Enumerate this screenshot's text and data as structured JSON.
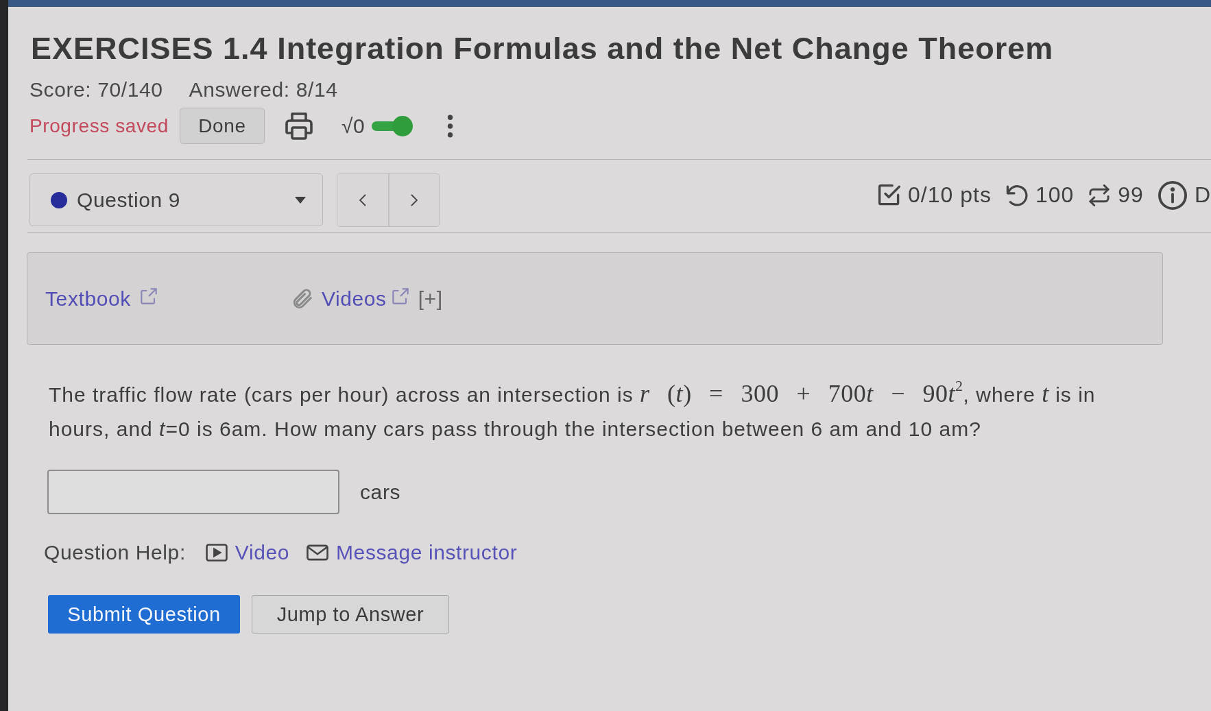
{
  "title": "EXERCISES 1.4 Integration Formulas and the Net Change Theorem",
  "score": "Score: 70/140",
  "answered": "Answered: 8/14",
  "toolbar": {
    "status": "Progress saved",
    "done_button": "Done",
    "math_toggle": {
      "label": "√0",
      "on": true
    }
  },
  "question_nav": {
    "question": "Question 9"
  },
  "stats": [
    {
      "kind": "points",
      "text": "0/10 pts"
    },
    {
      "kind": "retries",
      "text": "100"
    },
    {
      "kind": "attempts",
      "text": "99"
    },
    {
      "kind": "details",
      "text": "D"
    }
  ],
  "resources": [
    {
      "kind": "textbook",
      "label": "Textbook"
    },
    {
      "kind": "videos",
      "label": "Videos",
      "expand": "[+]"
    }
  ],
  "question": {
    "parts": [
      {
        "kind": "text",
        "text": "The traffic flow rate (cars per hour) across an intersection is "
      },
      {
        "kind": "var",
        "text": "r"
      },
      {
        "kind": "math",
        "text": " ("
      },
      {
        "kind": "var",
        "text": "t"
      },
      {
        "kind": "math",
        "text": ") = 300 + 700"
      },
      {
        "kind": "var",
        "text": "t"
      },
      {
        "kind": "math",
        "text": " − 90"
      },
      {
        "kind": "var",
        "text": "t"
      },
      {
        "kind": "sup",
        "text": "2"
      },
      {
        "kind": "text",
        "text": ", where "
      },
      {
        "kind": "var",
        "text": "t"
      },
      {
        "kind": "text",
        "text": " is in hours, and *t*=0 is 6am. How many cars pass through the intersection between 6 am and 10 am?"
      }
    ],
    "answer": {
      "unit": "cars"
    }
  },
  "help": {
    "label": "Question Help:",
    "links": [
      {
        "kind": "video",
        "label": "Video"
      },
      {
        "kind": "message",
        "label": "Message instructor"
      }
    ]
  },
  "buttons": [
    {
      "kind": "primary",
      "label": "Submit Question"
    },
    {
      "kind": "secondary",
      "label": "Jump to Answer"
    }
  ]
}
